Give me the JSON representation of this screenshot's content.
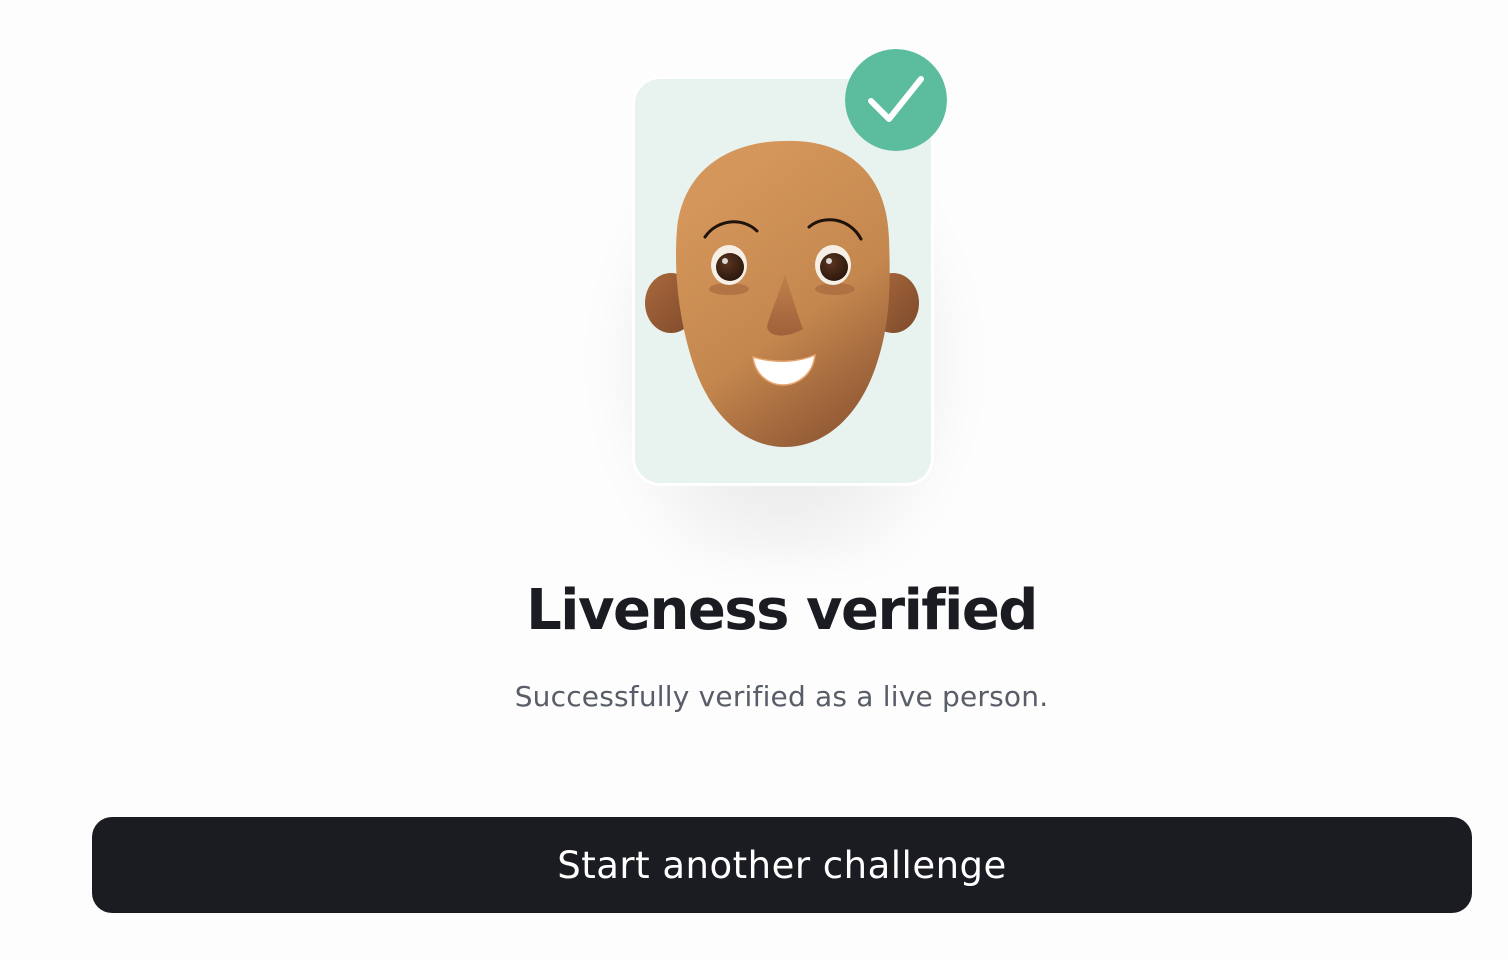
{
  "illustration": {
    "card_icon": "face-avatar-icon",
    "badge_icon": "checkmark-icon",
    "card_bg_color": "#e8f3ef",
    "badge_color": "#5bbd9e",
    "skin_color": "#c98a52"
  },
  "result": {
    "title": "Liveness verified",
    "message": "Successfully verified as a live person."
  },
  "actions": {
    "primary_label": "Start another challenge",
    "primary_bg_color": "#1b1c21"
  }
}
